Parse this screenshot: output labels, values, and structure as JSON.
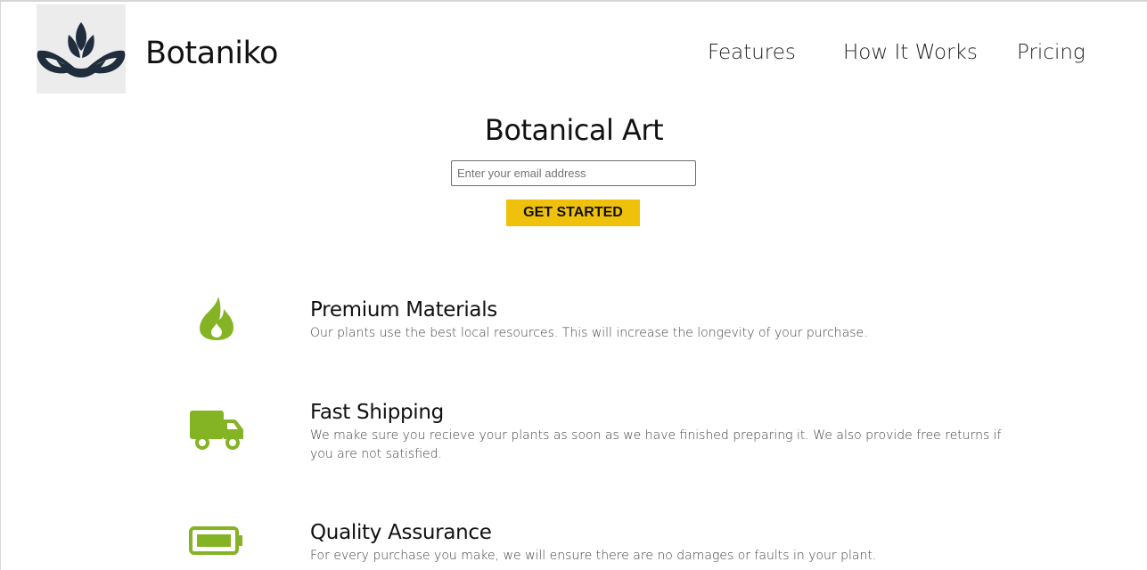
{
  "header": {
    "brand": "Botaniko",
    "nav": [
      {
        "label": "Features"
      },
      {
        "label": "How It Works"
      },
      {
        "label": "Pricing"
      }
    ]
  },
  "hero": {
    "title": "Botanical Art",
    "email_placeholder": "Enter your email address",
    "email_value": "",
    "cta_label": "GET STARTED"
  },
  "features": [
    {
      "icon": "fire-icon",
      "title": "Premium Materials",
      "description": "Our plants use the best local resources. This will increase the longevity of your purchase."
    },
    {
      "icon": "truck-icon",
      "title": "Fast Shipping",
      "description": "We make sure you recieve your plants as soon as we have finished preparing it. We also provide free returns if you are not satisfied."
    },
    {
      "icon": "battery-full-icon",
      "title": "Quality Assurance",
      "description": "For every purchase you make, we will ensure there are no damages or faults in your plant."
    }
  ],
  "colors": {
    "accent_yellow": "#f0c10b",
    "icon_green": "#84b424",
    "logo_navy": "#1f2d3d",
    "logo_bg": "#ececec"
  }
}
